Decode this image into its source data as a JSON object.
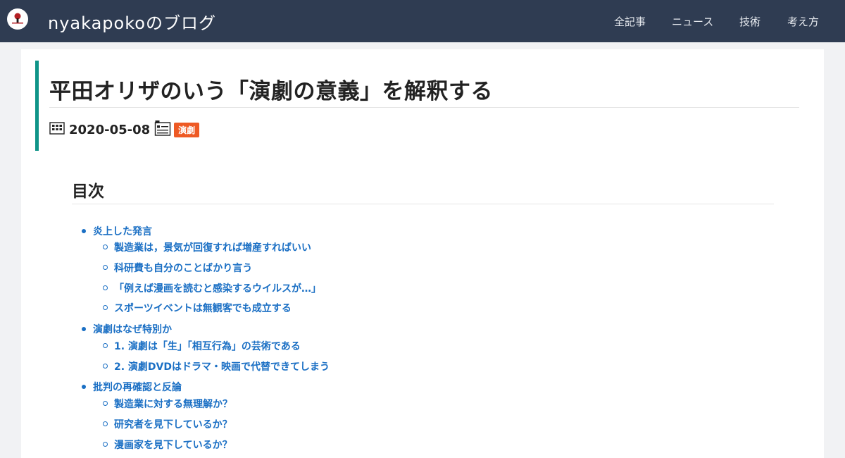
{
  "header": {
    "site_title": "nyakapokoのブログ",
    "nav": [
      "全記事",
      "ニュース",
      "技術",
      "考え方"
    ]
  },
  "post": {
    "title": "平田オリザのいう「演劇の意義」を解釈する",
    "date": "2020-05-08",
    "tag": "演劇"
  },
  "toc": {
    "heading": "目次",
    "sections": [
      {
        "label": "炎上した発言",
        "children": [
          "製造業は，景気が回復すれば増産すればいい",
          "科研費も自分のことばかり言う",
          "「例えば漫画を読むと感染するウイルスが…」",
          "スポーツイベントは無観客でも成立する"
        ]
      },
      {
        "label": "演劇はなぜ特別か",
        "children": [
          "1. 演劇は「生」「相互行為」の芸術である",
          "2. 演劇DVDはドラマ・映画で代替できてしまう"
        ]
      },
      {
        "label": "批判の再確認と反論",
        "children": [
          "製造業に対する無理解か？",
          "研究者を見下しているか？",
          "漫画家を見下しているか？"
        ]
      }
    ]
  },
  "colors": {
    "navbar": "#2f3c52",
    "accent": "#0f9488",
    "link": "#1a6fc4",
    "tag": "#ee5a24"
  },
  "icons": [
    "calendar-icon",
    "category-icon",
    "site-logo"
  ]
}
